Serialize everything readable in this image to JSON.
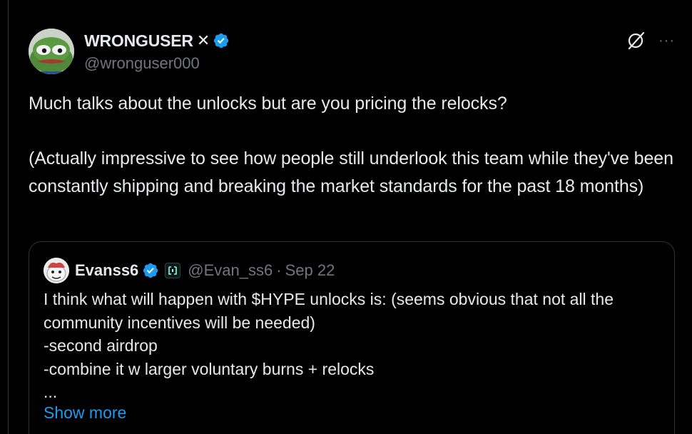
{
  "author": {
    "display_name": "WRONGUSER",
    "name_suffix": "✕",
    "handle": "@wronguser000",
    "avatar_icon": "frog-avatar",
    "verified_icon": "verified-badge-icon"
  },
  "actions": {
    "grok_icon": "grok-icon",
    "more_label": "···"
  },
  "tweet": {
    "paragraph_1": "Much talks about the unlocks but are you pricing the relocks?",
    "paragraph_2": "(Actually impressive to see how people still underlook this team while they've been constantly shipping and breaking the market standards for the past 18 months)"
  },
  "quote": {
    "display_name": "Evanss6",
    "handle": "@Evan_ss6",
    "separator": "·",
    "date": "Sep 22",
    "lines": [
      "I think what will happen with $HYPE unlocks is: (seems obvious that not all the",
      "community incentives will be needed)",
      "-second airdrop",
      "-combine it w larger voluntary burns + relocks",
      "..."
    ],
    "show_more_label": "Show more"
  },
  "colors": {
    "background": "#000000",
    "text_primary": "#e7e9ea",
    "text_secondary": "#71767b",
    "link": "#1d9bf0",
    "verified": "#1d9bf0",
    "border": "#2f3336"
  }
}
